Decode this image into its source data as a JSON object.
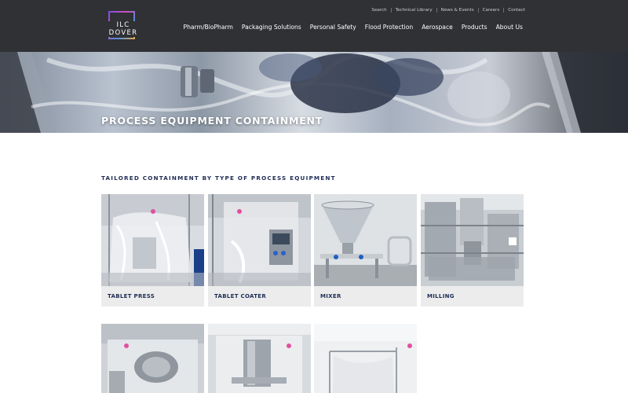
{
  "brand": {
    "logo_text": "ILC DOVER"
  },
  "utility_nav": [
    "Search",
    "Technical Library",
    "News & Events",
    "Careers",
    "Contact"
  ],
  "main_nav": [
    "Pharm/BioPharm",
    "Packaging Solutions",
    "Personal Safety",
    "Flood Protection",
    "Aerospace",
    "Products",
    "About Us"
  ],
  "hero": {
    "title": "PROCESS EQUIPMENT CONTAINMENT"
  },
  "section": {
    "heading": "TAILORED CONTAINMENT BY TYPE OF PROCESS EQUIPMENT",
    "cards": [
      {
        "label": "TABLET PRESS"
      },
      {
        "label": "TABLET COATER"
      },
      {
        "label": "MIXER"
      },
      {
        "label": "MILLING"
      }
    ]
  },
  "colors": {
    "header_bg": "#2f3134",
    "navy_text": "#1f2d55",
    "card_bg": "#ececec"
  }
}
